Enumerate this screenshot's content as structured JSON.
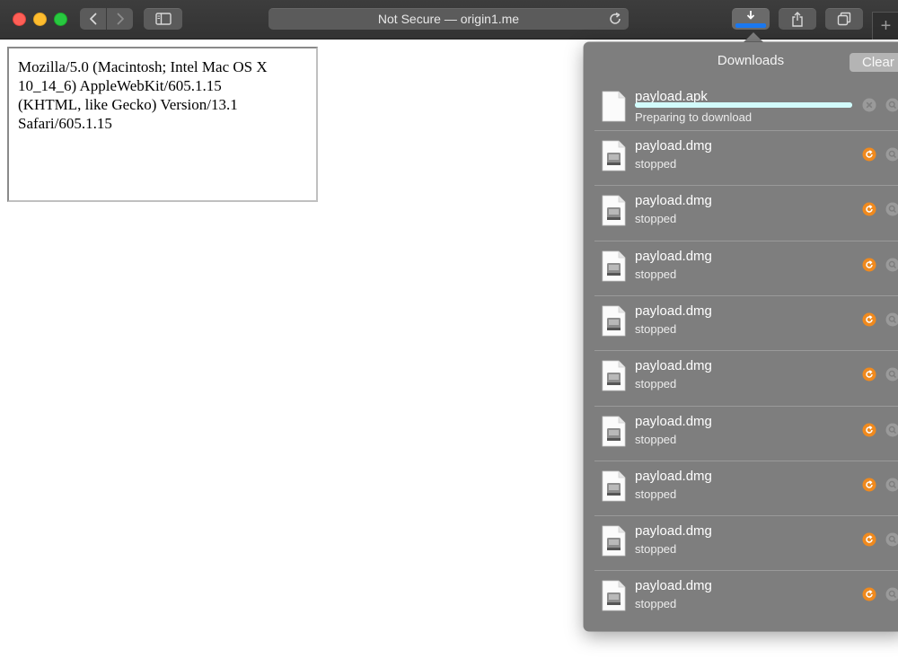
{
  "toolbar": {
    "address_text": "Not Secure — origin1.me",
    "new_tab_symbol": "+"
  },
  "page": {
    "user_agent": "Mozilla/5.0 (Macintosh; Intel Mac OS X\n10_14_6) AppleWebKit/605.1.15\n(KHTML, like Gecko) Version/13.1\nSafari/605.1.15"
  },
  "downloads": {
    "title": "Downloads",
    "clear_label": "Clear",
    "active": {
      "name": "payload.apk",
      "status": "Preparing to download",
      "progress": 1.0
    },
    "items": [
      {
        "name": "payload.dmg",
        "status": "stopped"
      },
      {
        "name": "payload.dmg",
        "status": "stopped"
      },
      {
        "name": "payload.dmg",
        "status": "stopped"
      },
      {
        "name": "payload.dmg",
        "status": "stopped"
      },
      {
        "name": "payload.dmg",
        "status": "stopped"
      },
      {
        "name": "payload.dmg",
        "status": "stopped"
      },
      {
        "name": "payload.dmg",
        "status": "stopped"
      },
      {
        "name": "payload.dmg",
        "status": "stopped"
      },
      {
        "name": "payload.dmg",
        "status": "stopped"
      }
    ]
  },
  "colors": {
    "resume_orange": "#f08a1e",
    "progress_cyan": "#a8f4f4",
    "download_button_blue": "#1a78f0"
  },
  "icons": {
    "cancel": "close-circle-icon",
    "resume": "resume-icon",
    "reveal": "magnifier-icon",
    "file_apk": "blank-document-icon",
    "file_dmg": "disk-image-icon"
  }
}
